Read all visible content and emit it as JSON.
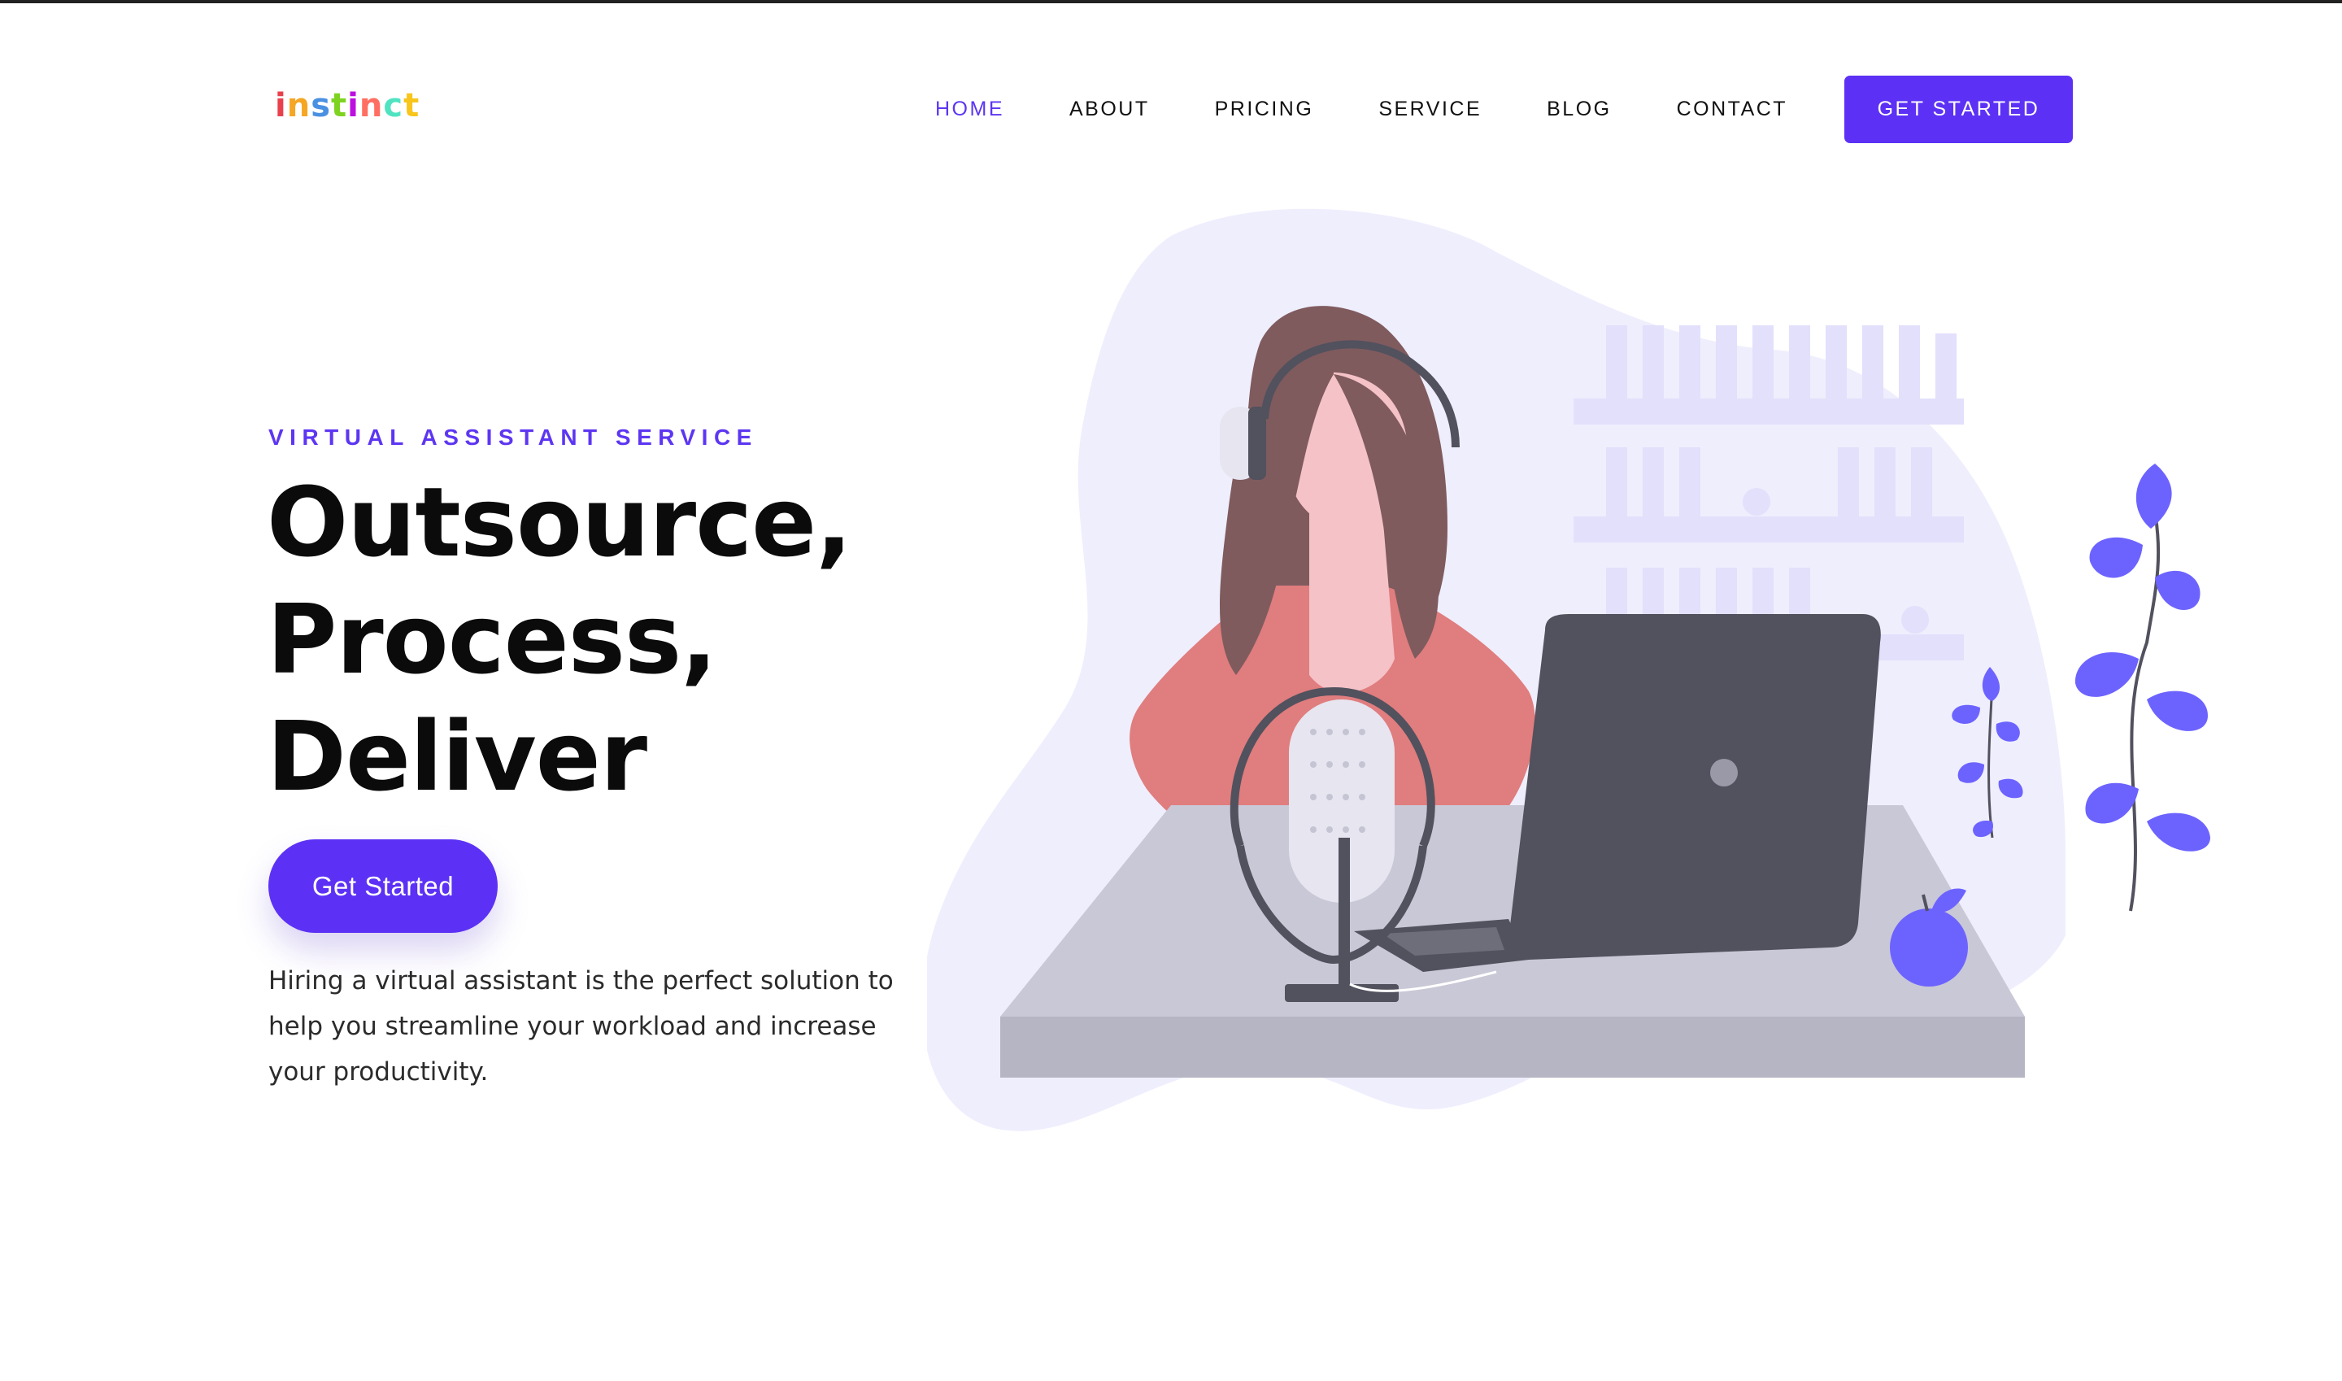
{
  "header": {
    "logo_text": "instinct",
    "logo_colors": [
      "#e8414d",
      "#f5a623",
      "#4a90e2",
      "#7ed321",
      "#bd10e0",
      "#ff6f61",
      "#50e3c2",
      "#f8c51c"
    ],
    "nav": [
      {
        "label": "HOME",
        "active": true
      },
      {
        "label": "ABOUT",
        "active": false
      },
      {
        "label": "PRICING",
        "active": false
      },
      {
        "label": "SERVICE",
        "active": false
      },
      {
        "label": "BLOG",
        "active": false
      },
      {
        "label": "CONTACT",
        "active": false
      }
    ],
    "cta_label": "GET STARTED"
  },
  "hero": {
    "eyebrow": "VIRTUAL ASSISTANT SERVICE",
    "headline": [
      "Outsource,",
      "Process,",
      "Deliver"
    ],
    "cta_label": "Get Started",
    "description": "Hiring a virtual assistant is the perfect solution to help you streamline your workload and increase your productivity."
  },
  "colors": {
    "accent": "#5c31f5",
    "nav_active": "#5d36f2",
    "blob": "#efeefd",
    "leaf": "#6c63ff",
    "laptop": "#52515e",
    "desk": "#c9c8d6",
    "desk_front": "#b6b5c3",
    "dress": "#e07d7e",
    "hair": "#7f5b5e",
    "skin": "#f4c2c7"
  },
  "illustration": {
    "icons": [
      "woman-with-headphones",
      "podcast-microphone-icon",
      "laptop-icon",
      "apple-icon",
      "plant-icon",
      "bookshelf-icon"
    ]
  }
}
